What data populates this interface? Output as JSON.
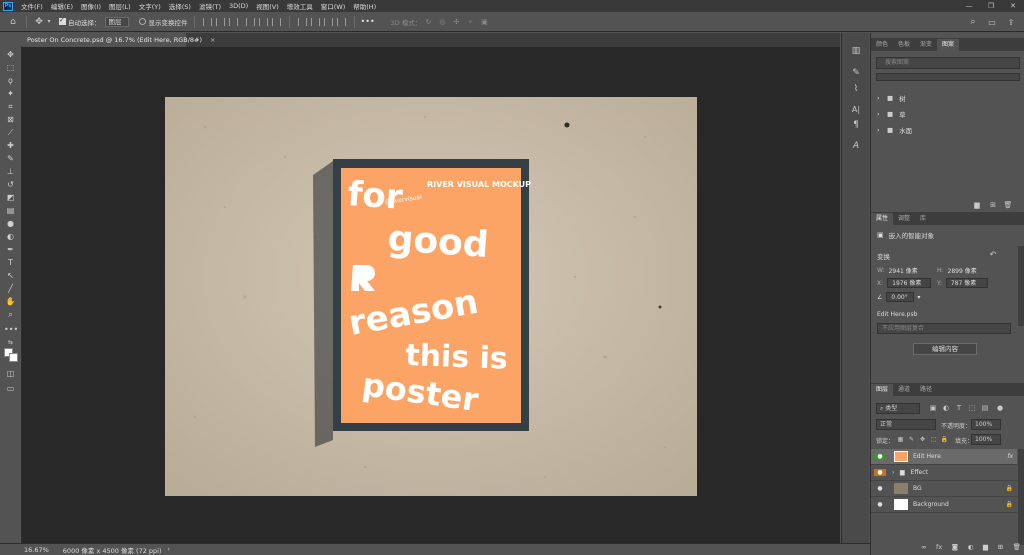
{
  "menubar": {
    "logo": "Ps",
    "items": [
      "文件(F)",
      "编辑(E)",
      "图像(I)",
      "图层(L)",
      "文字(Y)",
      "选择(S)",
      "滤镜(T)",
      "3D(D)",
      "视图(V)",
      "增效工具",
      "窗口(W)",
      "帮助(H)"
    ],
    "window_controls": [
      "—",
      "❐",
      "✕"
    ]
  },
  "options": {
    "auto_select_label": "自动选择：",
    "auto_select_value": "图层",
    "show_transform_label": "显示变换控件",
    "more": "•••",
    "mode_label": "3D 模式："
  },
  "document_tab": {
    "title": "Poster On Concrete.psd @ 16.7% (Edit Here, RGB/8#)",
    "close": "×"
  },
  "poster": {
    "line_for": "for",
    "line_good": "good",
    "line_reason": "reason",
    "line_this_is": "this is",
    "line_poster": "poster",
    "brand_title": "RIVER VISUAL MOCKUP",
    "brand_handle": "@rivervisual",
    "background_color": "#fca465",
    "frame_color": "#354046"
  },
  "status": {
    "zoom": "16.67%",
    "doc_size": "6000 像素 x 4500 像素 (72 ppi)"
  },
  "top_panel": {
    "tabs": [
      "颜色",
      "色板",
      "渐变",
      "图案"
    ],
    "active_tab": "图案",
    "search_placeholder": "搜索图案",
    "groups": [
      "树",
      "草",
      "水面"
    ]
  },
  "properties": {
    "tabs": [
      "属性",
      "调整",
      "库"
    ],
    "active_tab": "属性",
    "object_type": "嵌入的智能对象",
    "transform_label": "变换",
    "w_label": "W:",
    "w_value": "2941 像素",
    "h_label": "H:",
    "h_value": "2899 像素",
    "x_label": "X:",
    "x_value": "1976 像素",
    "y_label": "Y:",
    "y_value": "787 像素",
    "angle_value": "0.00°",
    "file_name": "Edit Here.psb",
    "comp_placeholder": "不应用图层复合",
    "edit_button": "编辑内容"
  },
  "layers_panel": {
    "tabs": [
      "图层",
      "通道",
      "路径"
    ],
    "active_tab": "图层",
    "filter_label": "类型",
    "blend_mode": "正常",
    "opacity_label": "不透明度：",
    "opacity_value": "100%",
    "lock_label": "锁定：",
    "fill_label": "填充：",
    "fill_value": "100%",
    "layers": [
      {
        "name": "Edit Here",
        "badge": "fx",
        "selected": true
      },
      {
        "name": "Effect",
        "type": "group"
      },
      {
        "name": "BG",
        "locked": true
      },
      {
        "name": "Background",
        "locked": true
      }
    ],
    "footer_icons": [
      "link-icon",
      "fx-icon",
      "mask-icon",
      "adjustment-icon",
      "group-icon",
      "new-layer-icon",
      "trash-icon"
    ]
  }
}
